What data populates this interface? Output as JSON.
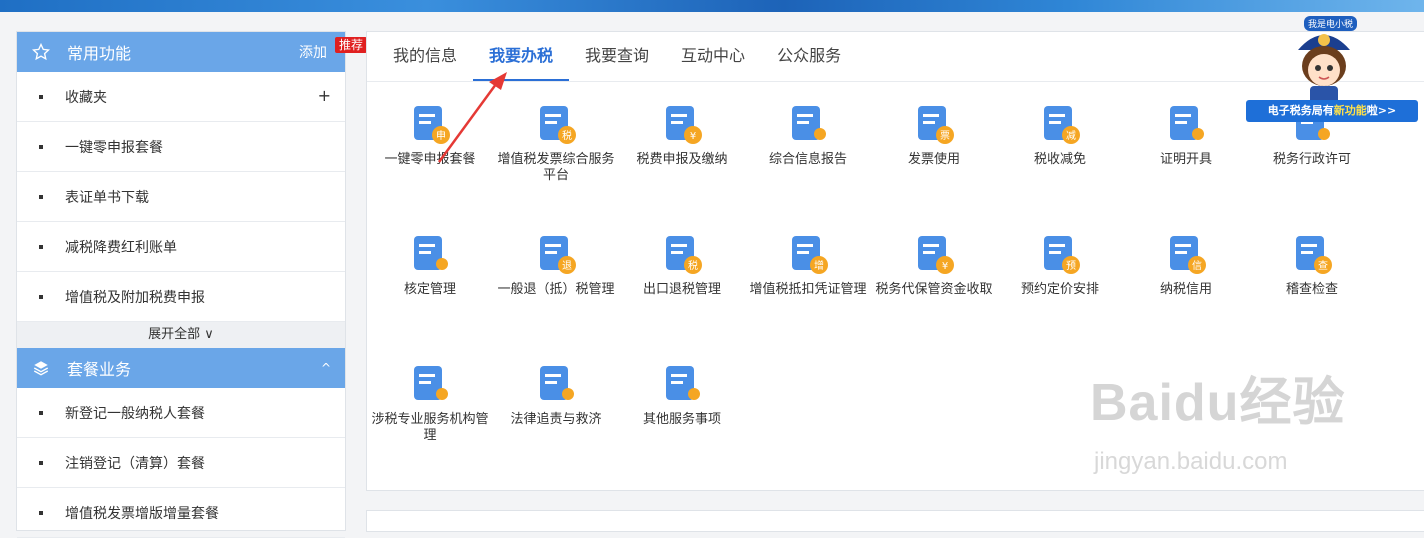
{
  "sidebar": {
    "common": {
      "title": "常用功能",
      "add_label": "添加",
      "badge": "推荐",
      "items": [
        {
          "label": "收藏夹",
          "extra": "+"
        },
        {
          "label": "一键零申报套餐"
        },
        {
          "label": "表证单书下载"
        },
        {
          "label": "减税降费红利账单"
        },
        {
          "label": "增值税及附加税费申报"
        }
      ],
      "expand_label": "展开全部 ∨"
    },
    "package": {
      "title": "套餐业务",
      "chevron": "^",
      "items": [
        {
          "label": "新登记一般纳税人套餐"
        },
        {
          "label": "注销登记（清算）套餐"
        },
        {
          "label": "增值税发票增版增量套餐"
        }
      ]
    }
  },
  "tabs": [
    "我的信息",
    "我要办税",
    "我要查询",
    "互动中心",
    "公众服务"
  ],
  "active_tab": "我要办税",
  "services": [
    {
      "label": "一键零申报套餐",
      "icon": "zero-declare-icon",
      "mark": "申"
    },
    {
      "label": "增值税发票综合服务平台",
      "icon": "invoice-platform-icon",
      "mark": "税"
    },
    {
      "label": "税费申报及缴纳",
      "icon": "tax-payment-icon",
      "mark": "¥"
    },
    {
      "label": "综合信息报告",
      "icon": "info-report-icon",
      "mark": ""
    },
    {
      "label": "发票使用",
      "icon": "invoice-use-icon",
      "mark": "票"
    },
    {
      "label": "税收减免",
      "icon": "tax-reduction-icon",
      "mark": "减"
    },
    {
      "label": "证明开具",
      "icon": "certificate-icon",
      "mark": ""
    },
    {
      "label": "税务行政许可",
      "icon": "permit-icon",
      "mark": ""
    },
    {
      "label": "核定管理",
      "icon": "assessment-icon",
      "mark": ""
    },
    {
      "label": "一般退（抵）税管理",
      "icon": "refund-icon",
      "mark": "退"
    },
    {
      "label": "出口退税管理",
      "icon": "export-refund-icon",
      "mark": "税"
    },
    {
      "label": "增值税抵扣凭证管理",
      "icon": "deduction-voucher-icon",
      "mark": "增"
    },
    {
      "label": "税务代保管资金收取",
      "icon": "custody-funds-icon",
      "mark": "¥"
    },
    {
      "label": "预约定价安排",
      "icon": "pricing-arrangement-icon",
      "mark": "预"
    },
    {
      "label": "纳税信用",
      "icon": "tax-credit-icon",
      "mark": "信"
    },
    {
      "label": "稽查检查",
      "icon": "inspection-icon",
      "mark": "查"
    },
    {
      "label": "涉税专业服务机构管理",
      "icon": "agency-management-icon",
      "mark": ""
    },
    {
      "label": "法律追责与救济",
      "icon": "legal-icon",
      "mark": ""
    },
    {
      "label": "其他服务事项",
      "icon": "other-services-icon",
      "mark": ""
    }
  ],
  "mascot": {
    "bubble": "我是电小税",
    "banner_prefix": "电子税务局有",
    "banner_highlight": "新功能",
    "banner_suffix": "啦>>"
  },
  "watermark": {
    "main": "Baidu经验",
    "sub": "jingyan.baidu.com"
  },
  "colors": {
    "accent": "#2b6fd6",
    "sidebar_header": "#6aa6e8",
    "icon_blue": "#4a8fe6",
    "icon_orange": "#f5a623"
  }
}
